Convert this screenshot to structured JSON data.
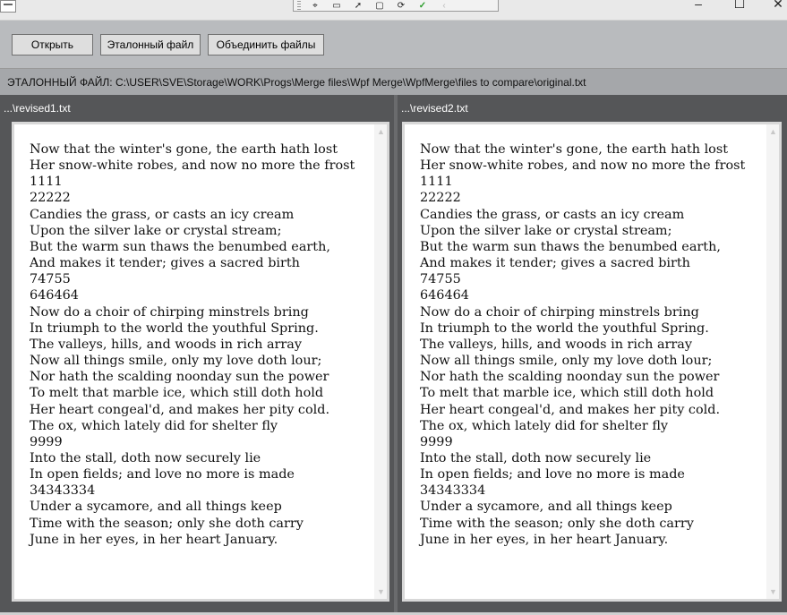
{
  "debug_toolbar": {
    "icons": [
      "select-element-icon",
      "display-layout-adorners-icon",
      "track-focused-element-icon",
      "select-element-icon-2",
      "hot-reload-icon",
      "check-icon",
      "back-icon"
    ]
  },
  "window_controls": {
    "minimize": "–",
    "maximize": "☐",
    "close": "✕"
  },
  "toolbar": {
    "open_label": "Открыть",
    "reference_label": "Эталонный файл",
    "merge_label": "Объединить файлы"
  },
  "reference_path": "ЭТАЛОННЫЙ ФАЙЛ: C:\\USER\\SVE\\Storage\\WORK\\Progs\\Merge files\\Wpf Merge\\WpfMerge\\files to compare\\original.txt",
  "left_pane": {
    "title": "...\\revised1.txt",
    "lines": [
      "Now that the winter's gone, the earth hath lost",
      "Her snow-white robes, and now no more the frost",
      "1111",
      "22222",
      "Candies the grass, or casts an icy cream",
      "Upon the silver lake or crystal stream;",
      "But the warm sun thaws the benumbed earth,",
      "And makes it tender; gives a sacred birth",
      "74755",
      "646464",
      "Now do a choir of chirping minstrels bring",
      "In triumph to the world the youthful Spring.",
      "The valleys, hills, and woods in rich array",
      "Now all things smile, only my love doth lour;",
      "Nor hath the scalding noonday sun the power",
      "To melt that marble ice, which still doth hold",
      "Her heart congeal'd, and makes her pity cold.",
      "The ox, which lately did for shelter fly",
      "9999",
      "Into the stall, doth now securely lie",
      "In open fields; and love no more is made",
      "34343334",
      "Under a sycamore, and all things keep",
      "Time with the season; only she doth carry",
      "June in her eyes, in her heart January."
    ]
  },
  "right_pane": {
    "title": "...\\revised2.txt",
    "lines": [
      "Now that the winter's gone, the earth hath lost",
      "Her snow-white robes, and now no more the frost",
      "1111",
      "22222",
      "Candies the grass, or casts an icy cream",
      "Upon the silver lake or crystal stream;",
      "But the warm sun thaws the benumbed earth,",
      "And makes it tender; gives a sacred birth",
      "74755",
      "646464",
      "Now do a choir of chirping minstrels bring",
      "In triumph to the world the youthful Spring.",
      "The valleys, hills, and woods in rich array",
      "Now all things smile, only my love doth lour;",
      "Nor hath the scalding noonday sun the power",
      "To melt that marble ice, which still doth hold",
      "Her heart congeal'd, and makes her pity cold.",
      "The ox, which lately did for shelter fly",
      "9999",
      "Into the stall, doth now securely lie",
      "In open fields; and love no more is made",
      "34343334",
      "Under a sycamore, and all things keep",
      "Time with the season; only she doth carry",
      "June in her eyes, in her heart January."
    ]
  }
}
